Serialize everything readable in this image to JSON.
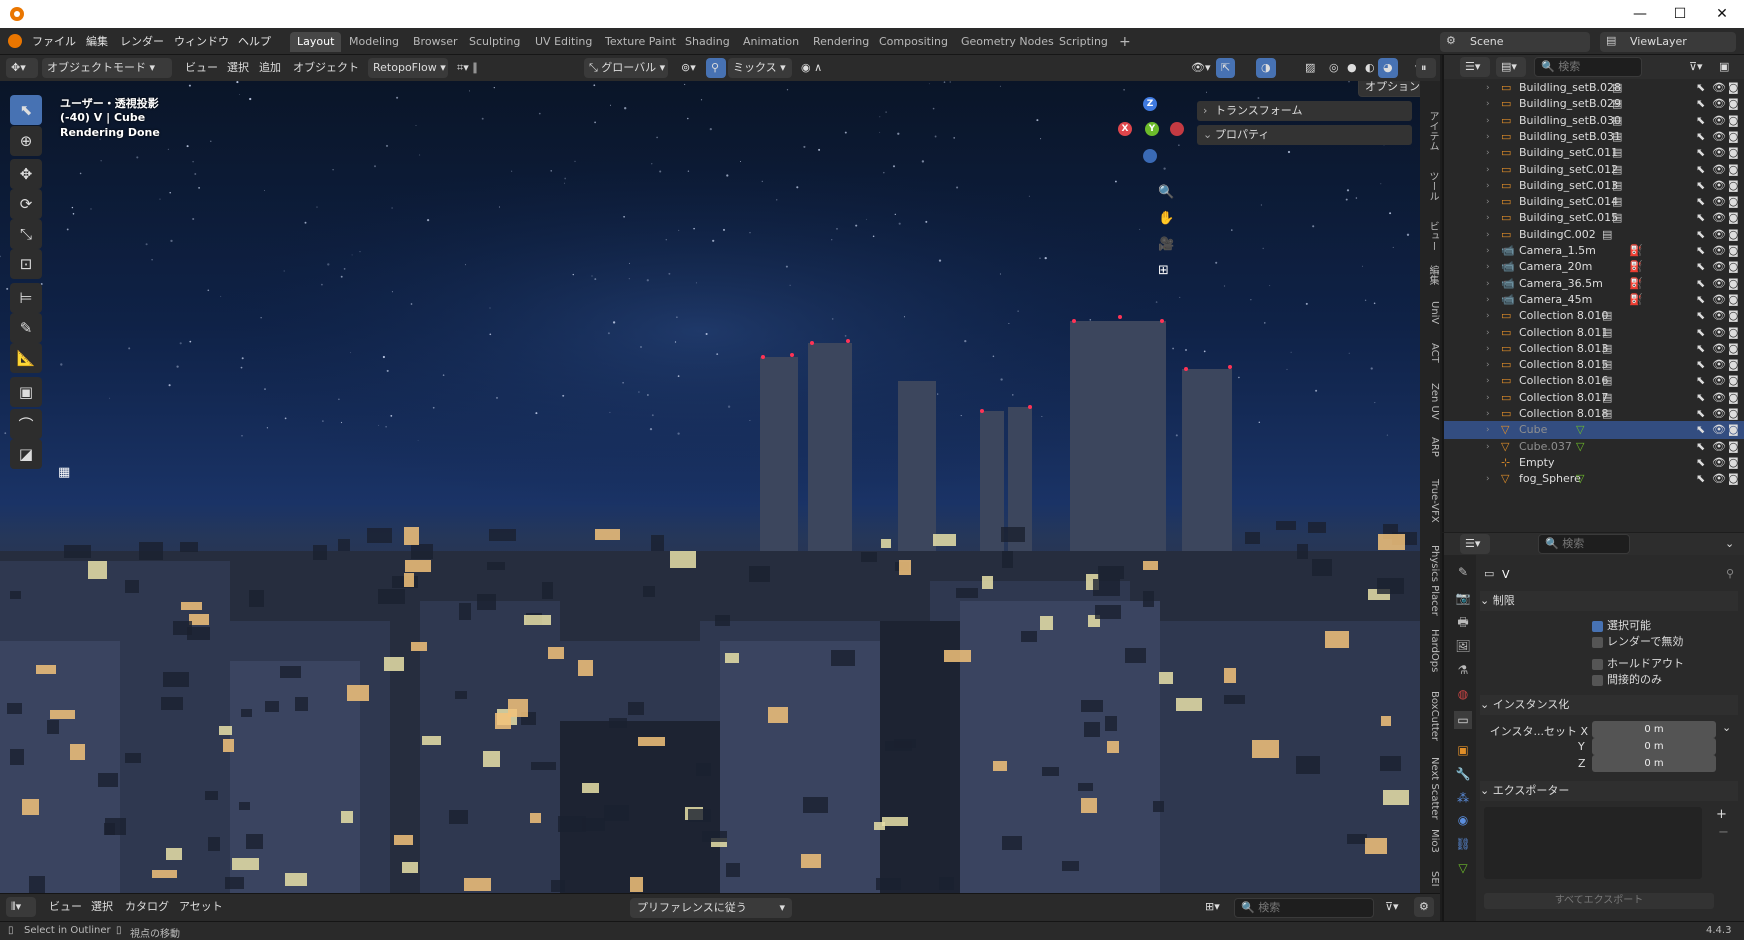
{
  "window": {
    "minimize": "—",
    "maximize": "☐",
    "close": "✕"
  },
  "menu": [
    "ファイル",
    "編集",
    "レンダー",
    "ウィンドウ",
    "ヘルプ"
  ],
  "workspaces": [
    "Layout",
    "Modeling",
    "Browser",
    "Sculpting",
    "UV Editing",
    "Texture Paint",
    "Shading",
    "Animation",
    "Rendering",
    "Compositing",
    "Geometry Nodes",
    "Scripting"
  ],
  "active_workspace": "Layout",
  "add_tab": "+",
  "scene": {
    "name": "Scene",
    "view_layer": "ViewLayer"
  },
  "view_header": {
    "mode": "オブジェクトモード",
    "items": [
      "ビュー",
      "選択",
      "追加",
      "オブジェクト"
    ],
    "addon": "RetopoFlow",
    "transform_orientation": "グローバル",
    "snap_mode": "ミックス",
    "options": "オプション"
  },
  "overlay_text": {
    "view": "ユーザー・透視投影",
    "object": "(-40) V | Cube",
    "status": "Rendering Done"
  },
  "n_panel": {
    "transform": "トランスフォーム",
    "properties": "プロパティ"
  },
  "side_tabs": [
    "アイテム",
    "ツール",
    "ビュー",
    "編集",
    "UniV",
    "ACT",
    "Zen UV",
    "ARP",
    "True-VFX",
    "Physics Placer",
    "HardOps",
    "BoxCutter",
    "Next Scatter",
    "Mio3",
    "SEI"
  ],
  "gizmo": {
    "x": "X",
    "y": "Y",
    "z": "Z"
  },
  "outliner": {
    "search_placeholder": "検索",
    "rows": [
      {
        "name": "Buildling_setB.028",
        "type": "collection"
      },
      {
        "name": "Buildling_setB.029",
        "type": "collection"
      },
      {
        "name": "Buildling_setB.030",
        "type": "collection"
      },
      {
        "name": "Buildling_setB.031",
        "type": "collection"
      },
      {
        "name": "Building_setC.011",
        "type": "collection"
      },
      {
        "name": "Building_setC.012",
        "type": "collection"
      },
      {
        "name": "Building_setC.013",
        "type": "collection"
      },
      {
        "name": "Building_setC.014",
        "type": "collection"
      },
      {
        "name": "Building_setC.015",
        "type": "collection"
      },
      {
        "name": "BuildingC.002",
        "type": "collection"
      },
      {
        "name": "Camera_1.5m",
        "type": "camera"
      },
      {
        "name": "Camera_20m",
        "type": "camera"
      },
      {
        "name": "Camera_36.5m",
        "type": "camera"
      },
      {
        "name": "Camera_45m",
        "type": "camera"
      },
      {
        "name": "Collection 8.010",
        "type": "collection"
      },
      {
        "name": "Collection 8.011",
        "type": "collection"
      },
      {
        "name": "Collection 8.013",
        "type": "collection"
      },
      {
        "name": "Collection 8.015",
        "type": "collection"
      },
      {
        "name": "Collection 8.016",
        "type": "collection"
      },
      {
        "name": "Collection 8.017",
        "type": "collection"
      },
      {
        "name": "Collection 8.018",
        "type": "collection"
      },
      {
        "name": "Cube",
        "type": "mesh",
        "selected": true
      },
      {
        "name": "Cube.037",
        "type": "mesh"
      },
      {
        "name": "Empty",
        "type": "empty"
      },
      {
        "name": "fog_Sphere",
        "type": "mesh"
      }
    ]
  },
  "properties": {
    "search_placeholder": "検索",
    "object_name": "V",
    "restrictions": {
      "title": "制限",
      "selectable": "選択可能",
      "disable_render": "レンダーで無効",
      "holdout": "ホールドアウト",
      "indirect_only": "間接的のみ"
    },
    "instancing": {
      "title": "インスタンス化",
      "offset_label": "インスタ...セット X",
      "y_label": "Y",
      "z_label": "Z",
      "x": "0 m",
      "y": "0 m",
      "z": "0 m"
    },
    "exporters": {
      "title": "エクスポーター",
      "export_all": "すべてエクスポート"
    }
  },
  "asset_bar": {
    "items": [
      "ビュー",
      "選択",
      "カタログ",
      "アセット"
    ],
    "import": "プリファレンスに従う",
    "search_placeholder": "検索"
  },
  "status_bar": {
    "select": "Select in Outliner",
    "move": "視点の移動",
    "version": "4.4.3"
  },
  "colors": {
    "accent": "#4772b3",
    "selected_row": "#334d80",
    "orange": "#e08e28",
    "titlebar": "#ffffff"
  }
}
